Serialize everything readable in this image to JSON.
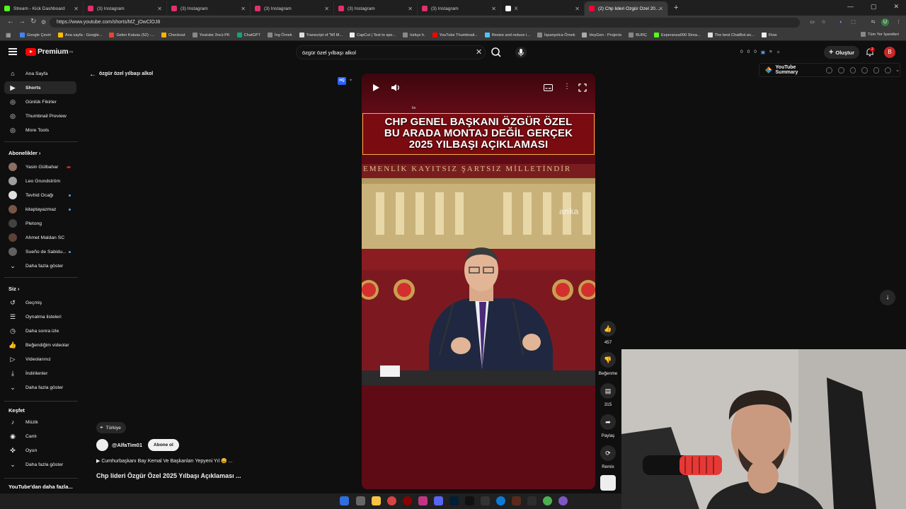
{
  "browser": {
    "tabs": [
      {
        "title": "Stream - Kick Dashboard",
        "color": "#53fc18",
        "active": false
      },
      {
        "title": "(3) Instagram",
        "color": "#e1306c",
        "active": false
      },
      {
        "title": "(3) Instagram",
        "color": "#e1306c",
        "active": false
      },
      {
        "title": "(3) Instagram",
        "color": "#e1306c",
        "active": false
      },
      {
        "title": "(3) Instagram",
        "color": "#e1306c",
        "active": false
      },
      {
        "title": "(3) Instagram",
        "color": "#e1306c",
        "active": false
      },
      {
        "title": "X",
        "color": "#ffffff",
        "active": false
      },
      {
        "title": "(2) Chp lideri Özgür Özel 2025",
        "color": "#ff0033",
        "active": true
      }
    ],
    "new_tab": "+",
    "url": "https://www.youtube.com/shorts/MZ_jOwClOJ8",
    "bookmarks": [
      {
        "label": "Google Çeviri",
        "color": "#4285f4"
      },
      {
        "label": "Ana sayfa - Google...",
        "color": "#fbbc04"
      },
      {
        "label": "Gelen Kutusu (52) -...",
        "color": "#ea4335"
      },
      {
        "label": "Checkout",
        "color": "#f4b400"
      },
      {
        "label": "Youtube 3ncü PK",
        "color": "#888888"
      },
      {
        "label": "ChatGPT",
        "color": "#10a37f"
      },
      {
        "label": "İng Örnek",
        "color": "#888888"
      },
      {
        "label": "Transcript of \"Mİ M...",
        "color": "#dddddd"
      },
      {
        "label": "CapCut | Test to spe...",
        "color": "#eeeeee"
      },
      {
        "label": "türkçe h.",
        "color": "#888888"
      },
      {
        "label": "YouTube Thumbnail...",
        "color": "#ff0000"
      },
      {
        "label": "Resize and reduce i...",
        "color": "#4fc3f7"
      },
      {
        "label": "İspanyolca Örnek",
        "color": "#888888"
      },
      {
        "label": "HeyGen - Projects",
        "color": "#aaaaaa"
      },
      {
        "label": "BURÇ",
        "color": "#888888"
      },
      {
        "label": "Esperanza000 Strea...",
        "color": "#53fc18"
      },
      {
        "label": "The best ChatBot an...",
        "color": "#dddddd"
      },
      {
        "label": "Flow",
        "color": "#eeeeee"
      }
    ],
    "all_bookmarks": "Tüm Yer İşaretleri"
  },
  "youtube": {
    "logo_word": "Premium",
    "logo_sup": "TR",
    "search": {
      "value": "özgür özel yılbaşı alkol"
    },
    "ext_stats": [
      "0",
      "0",
      "0"
    ],
    "create_label": "Oluştur",
    "notification_count": "2",
    "avatar_letter": "B",
    "summary_label": "YouTube Summary"
  },
  "sidebar": {
    "main": [
      {
        "label": "Ana Sayfa",
        "icon": "home-icon"
      },
      {
        "label": "Shorts",
        "icon": "shorts-icon"
      },
      {
        "label": "Günlük Fikirler",
        "icon": "gpt-icon"
      },
      {
        "label": "Thumbnail Preview",
        "icon": "gpt-icon"
      },
      {
        "label": "More Tools",
        "icon": "gpt-icon"
      }
    ],
    "subscriptions_heading": "Abonelikler",
    "subscriptions": [
      {
        "label": "Yasin Gülbahar",
        "color": "#8d6e63",
        "live": "red"
      },
      {
        "label": "Leo Grundström",
        "color": "#9e9e9e",
        "live": ""
      },
      {
        "label": "Tevhid Ocağı",
        "color": "#e0e0e0",
        "live": "blue"
      },
      {
        "label": "kitaptayazmaz",
        "color": "#795548",
        "live": "blue"
      },
      {
        "label": "Pletong",
        "color": "#424242",
        "live": ""
      },
      {
        "label": "Ahmet Maldan SC",
        "color": "#5d4037",
        "live": ""
      },
      {
        "label": "Sueño de Sabidu...",
        "color": "#616161",
        "live": "blue"
      }
    ],
    "subscriptions_more": "Daha fazla göster",
    "you_heading": "Siz",
    "you": [
      {
        "label": "Geçmiş",
        "icon": "history-icon"
      },
      {
        "label": "Oynatma listeleri",
        "icon": "playlists-icon"
      },
      {
        "label": "Daha sonra izle",
        "icon": "watch-later-icon"
      },
      {
        "label": "Beğendiğim videolar",
        "icon": "liked-icon"
      },
      {
        "label": "Videolarınız",
        "icon": "your-videos-icon"
      },
      {
        "label": "İndirilenler",
        "icon": "download-icon"
      },
      {
        "label": "Daha fazla göster",
        "icon": "chevron-down-icon"
      }
    ],
    "explore_heading": "Keşfet",
    "explore": [
      {
        "label": "Müzik",
        "icon": "music-icon"
      },
      {
        "label": "Canlı",
        "icon": "live-icon"
      },
      {
        "label": "Oyun",
        "icon": "gaming-icon"
      },
      {
        "label": "Daha fazla göster",
        "icon": "chevron-down-icon"
      }
    ],
    "more_from_youtube": "YouTube'dan daha fazla..."
  },
  "short": {
    "query_label": "özgür özel yılbaşı alkol",
    "hq_badge": "HQ",
    "small_text": "bs",
    "banner_lines": [
      "CHP GENEL BAŞKANI ÖZGÜR ÖZEL",
      "BU ARADA MONTAJ DEĞİL GERÇEK",
      "2025 YILBAŞI AÇIKLAMASI"
    ],
    "motto": "EMENLİK KAYITSIZ ŞARTSIZ MİLLETİNDİR",
    "watermark": "anka",
    "likes": "457",
    "dislike_label": "Beğenme",
    "comments": "315",
    "share_label": "Paylaş",
    "remix_label": "Remix",
    "location": "Türkiye",
    "channel": "@AlfaTim01",
    "subscribe_label": "Abone ol",
    "description": "▶ Cumhurbaşkanı Bay Kemal Ve Başkanları Yepyeni Yıl 😄 ...",
    "title": "Chp lideri Özgür Özel 2025 Yılbaşı Açıklaması ..."
  }
}
